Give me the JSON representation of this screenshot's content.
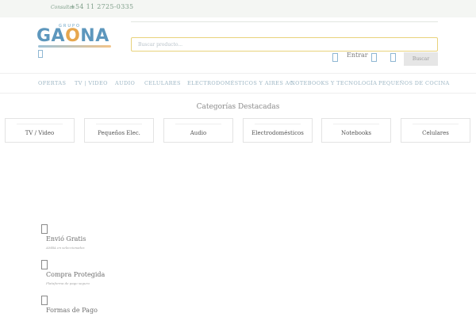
{
  "topbar": {
    "phone_label": "Consultas",
    "phone": "+54 11 2725-0335"
  },
  "logo": {
    "small": "GRUPO",
    "main_pre": "GA",
    "main_o": "O",
    "main_post": "NA"
  },
  "search": {
    "placeholder": "Buscar producto...",
    "button_label": "Buscar"
  },
  "account": {
    "login_label": "Entrar"
  },
  "nav": {
    "items": [
      "OFERTAS",
      "TV | VIDEO",
      "AUDIO",
      "CELULARES",
      "ELECTRODOMÉSTICOS Y AIRES AC.",
      "NOTEBOOKS Y TECNOLOGÍA",
      "PEQUEÑOS DE COCINA"
    ]
  },
  "categories": {
    "title": "Categorías Destacadas",
    "items": [
      "TV / Video",
      "Pequeños Elec.",
      "Audio",
      "Electrodomésticos",
      "Notebooks",
      "Celulares"
    ]
  },
  "features": [
    {
      "title": "Envió Gratis",
      "subtitle": "AMBA en seleccionados"
    },
    {
      "title": "Compra Protegida",
      "subtitle": "Plataforma de pago seguro"
    },
    {
      "title": "Formas de Pago",
      "subtitle": ""
    }
  ],
  "colors": {
    "accent": "#5d97bd",
    "logo_orange": "#e7a74e",
    "search_border": "#e8d27b"
  }
}
